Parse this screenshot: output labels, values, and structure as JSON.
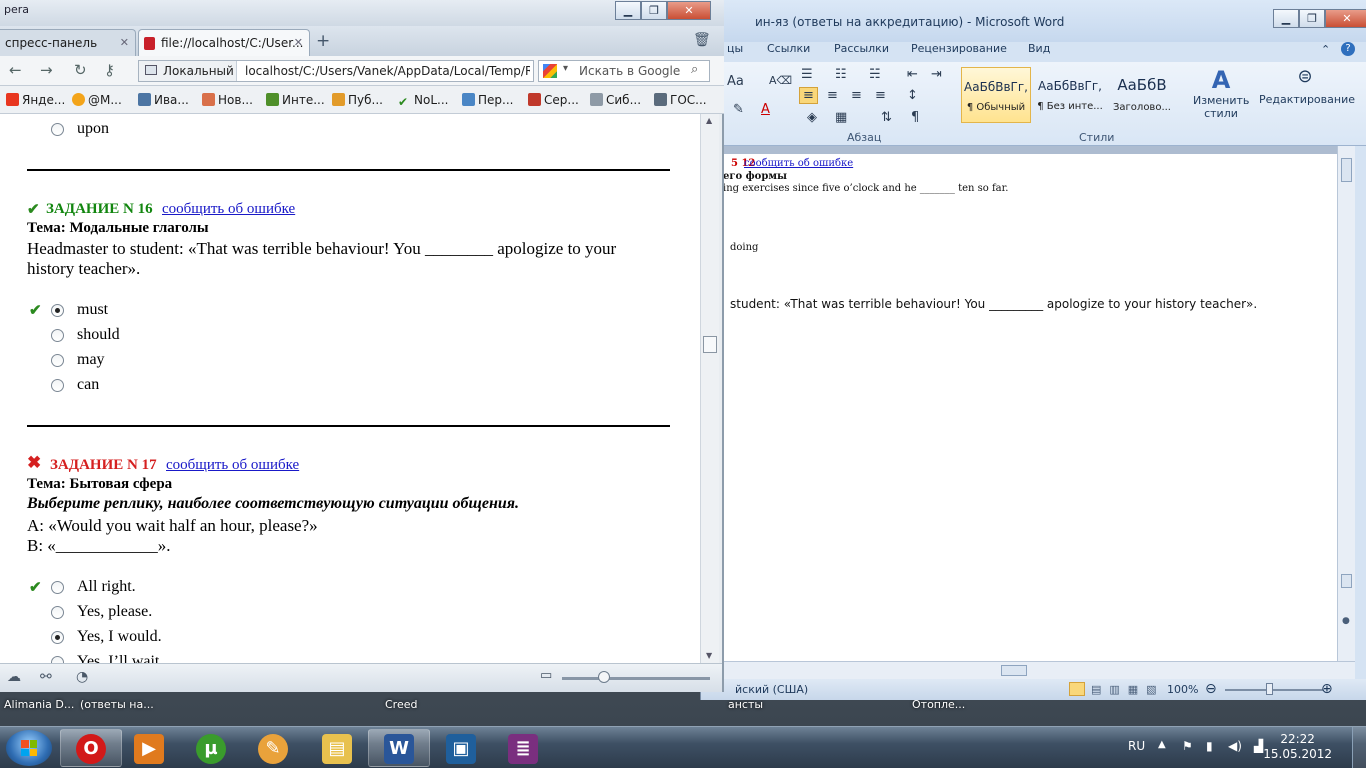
{
  "desktop": {
    "labels": [
      "Alimania D...",
      "(ответы на...",
      "Creed",
      "ансты",
      "Отопле..."
    ]
  },
  "word": {
    "title": "ин-яз (ответы на аккредитацию)  -  Microsoft Word",
    "tabs": [
      "цы",
      "Ссылки",
      "Рассылки",
      "Рецензирование",
      "Вид"
    ],
    "font_icons": [
      "Aa",
      "A"
    ],
    "styles": [
      {
        "preview": "АаБбВвГг,",
        "name": "¶ Обычный"
      },
      {
        "preview": "АаБбВвГг,",
        "name": "¶ Без инте..."
      },
      {
        "preview": "АаБбВ",
        "name": "Заголово..."
      }
    ],
    "change_styles": "Изменить стили",
    "editing": "Редактирование",
    "group_paragraph": "Абзац",
    "group_styles": "Стили",
    "doc_lines": [
      {
        "prefix": "5 12",
        "link": "сообщить об ошибке"
      },
      {
        "text": "его формы"
      },
      {
        "text": "ing exercises since five o’clock and he _______ ten so far."
      },
      {
        "text": "doing"
      },
      {
        "text": "student: «That was terrible behaviour! You _________ apologize to your history teacher»."
      }
    ],
    "status_lang": "йский (США)",
    "zoom": "100%"
  },
  "opera": {
    "title_fragment": "pera",
    "tabs": [
      {
        "label": "спресс-панель"
      },
      {
        "label": "file://localhost/C:/User..."
      }
    ],
    "address_zone": "Локальный",
    "address_url": "localhost/C:/Users/Vanek/AppData/Local/Temp/Ra",
    "search_placeholder": "Искать в Google",
    "bookmarks": [
      "Янде...",
      "@M...",
      "Ива...",
      "Нов...",
      "Инте...",
      "Пуб...",
      "NoL...",
      "Пер...",
      "Сер...",
      "Сиб...",
      "ГОС..."
    ],
    "content": {
      "prev_option": "upon",
      "task16": {
        "title": "ЗАДАНИЕ N 16",
        "report": "сообщить об ошибке",
        "topic": "Тема: Модальные глаголы",
        "question_l1": "Headmaster to student: «That was terrible behaviour! You ________ apologize to your",
        "question_l2": "history teacher».",
        "options": [
          "must",
          "should",
          "may",
          "can"
        ]
      },
      "task17": {
        "title": "ЗАДАНИЕ N 17",
        "report": "сообщить об ошибке",
        "topic": "Тема: Бытовая сфера",
        "instruction": "Выберите реплику, наиболее соответствующую ситуации общения.",
        "line_a": "A: «Would you wait half an hour, please?»",
        "line_b": "B: «____________».",
        "options": [
          "All right.",
          "Yes, please.",
          "Yes, I would.",
          "Yes, I’ll wait."
        ]
      }
    }
  },
  "taskbar": {
    "lang": "RU",
    "time": "22:22",
    "date": "15.05.2012",
    "apps": [
      "opera",
      "media-player",
      "utorrent",
      "paint",
      "explorer",
      "word",
      "video-converter",
      "winrar"
    ]
  },
  "colors": {
    "correct": "#2b8a1f",
    "wrong": "#d52020",
    "link": "#1919c8"
  }
}
